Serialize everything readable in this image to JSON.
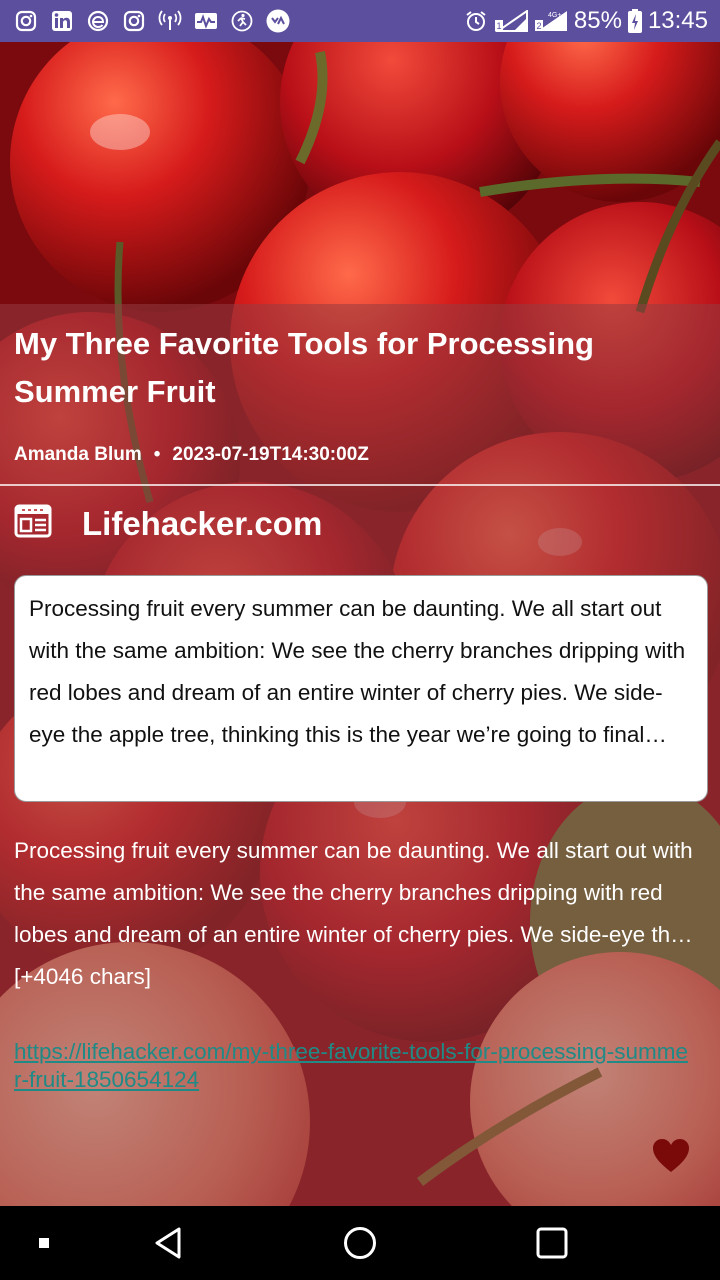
{
  "status_bar": {
    "notification_icons": [
      "instagram-icon",
      "linkedin-icon",
      "edge-browser-icon",
      "instagram-icon",
      "wifi-calling-icon",
      "activity-icon",
      "fitness-icon",
      "app-icon"
    ],
    "alarm_icon": "alarm-icon",
    "battery": "85%",
    "time": "13:45"
  },
  "article": {
    "title": "My Three Favorite Tools for Processing Summer Fruit",
    "author": "Amanda Blum",
    "separator": "•",
    "published": "2023-07-19T14:30:00Z",
    "source_icon": "newspaper-icon",
    "source": "Lifehacker.com",
    "description": "Processing fruit every summer can be daunting. We all start out with the same ambition: We see the cherry branches dripping with red lobes and dream of an entire winter of cherry pies. We side-eye the apple tree, thinking this is the year we’re going to final…",
    "content": "Processing fruit every summer can be daunting. We all start out with the same ambition: We see the cherry branches dripping with red lobes and dream of an entire winter of cherry pies. We side-eye th… [+4046 chars]",
    "url": "https://lifehacker.com/my-three-favorite-tools-for-processing-summer-fruit-1850654124",
    "favorite_icon": "heart-icon"
  },
  "colors": {
    "status_bar": "#5b4f9e",
    "link": "#1f8a86",
    "heart": "#7a0a0a"
  },
  "nav_bar": {
    "icons": [
      "menu-dot-icon",
      "back-icon",
      "home-icon",
      "recents-icon"
    ]
  }
}
